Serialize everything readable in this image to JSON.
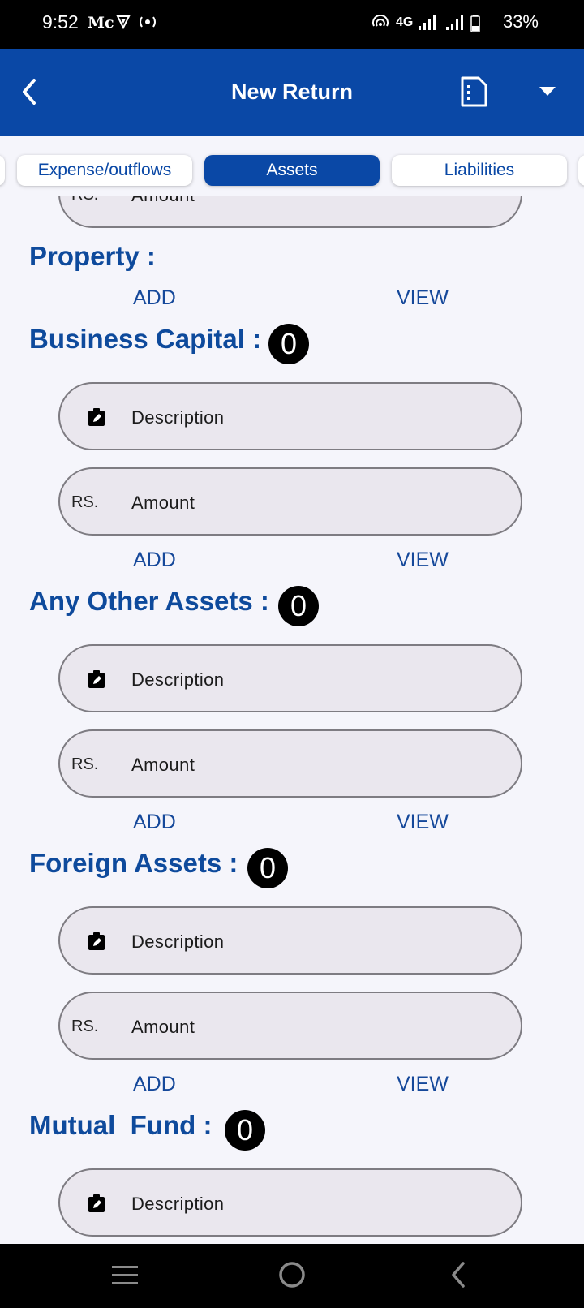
{
  "status_bar": {
    "time": "9:52",
    "carrier_mark": "Mc",
    "network": "4G",
    "battery": "33%"
  },
  "app_bar": {
    "title": "New Return",
    "back_icon": "chevron-left-icon",
    "doc_icon": "document-icon",
    "menu_icon": "dropdown-arrow-icon"
  },
  "tabs": [
    {
      "label": "Expense/outflows",
      "active": false
    },
    {
      "label": "Assets",
      "active": true
    },
    {
      "label": "Liabilities",
      "active": false
    }
  ],
  "top_partial": {
    "prefix": "RS.",
    "placeholder": "Amount"
  },
  "sections": {
    "property": {
      "title": "Property :",
      "add": "ADD",
      "view": "VIEW"
    },
    "business_capital": {
      "title": "Business Capital :",
      "count": "0",
      "description_placeholder": "Description",
      "amount_prefix": "RS.",
      "amount_placeholder": "Amount",
      "add": "ADD",
      "view": "VIEW"
    },
    "other_assets": {
      "title": "Any Other Assets :",
      "count": "0",
      "description_placeholder": "Description",
      "amount_prefix": "RS.",
      "amount_placeholder": "Amount",
      "add": "ADD",
      "view": "VIEW"
    },
    "foreign_assets": {
      "title": "Foreign Assets :",
      "count": "0",
      "description_placeholder": "Description",
      "amount_prefix": "RS.",
      "amount_placeholder": "Amount",
      "add": "ADD",
      "view": "VIEW"
    },
    "mutual_fund": {
      "title": "Mutual  Fund :",
      "count": "0",
      "description_placeholder": "Description"
    }
  },
  "colors": {
    "primary": "#0a48a6",
    "heading": "#0e4a9c",
    "field_bg": "#eae7ee",
    "field_border": "#7e7c82",
    "page_bg": "#f5f5fb"
  }
}
